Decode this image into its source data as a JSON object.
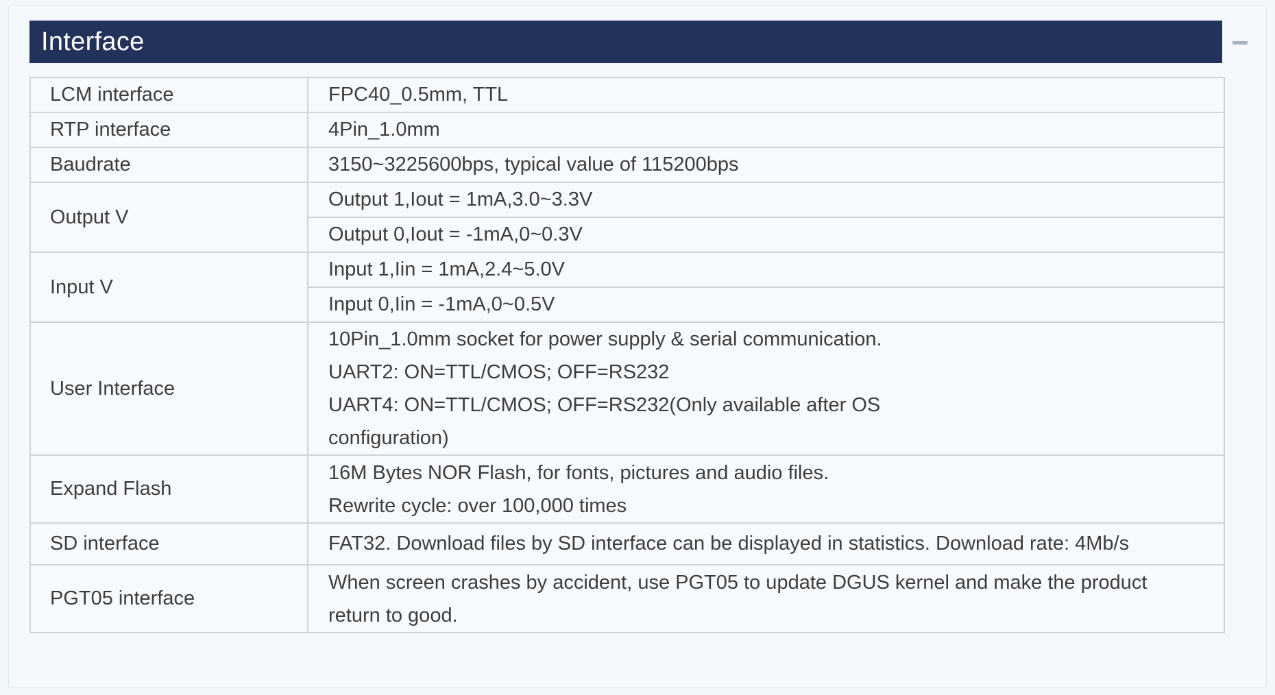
{
  "section": {
    "title": "Interface"
  },
  "rows": [
    {
      "label": "LCM interface",
      "values": [
        "FPC40_0.5mm, TTL"
      ]
    },
    {
      "label": "RTP interface",
      "values": [
        "4Pin_1.0mm"
      ]
    },
    {
      "label": "Baudrate",
      "values": [
        "3150~3225600bps, typical value of 115200bps"
      ]
    },
    {
      "label": "Output V",
      "values": [
        "Output 1,Iout = 1mA,3.0~3.3V",
        "Output 0,Iout = -1mA,0~0.3V"
      ]
    },
    {
      "label": "Input V",
      "values": [
        "Input 1,Iin = 1mA,2.4~5.0V",
        "Input 0,Iin = -1mA,0~0.5V"
      ]
    },
    {
      "label": "User Interface",
      "lines": [
        "10Pin_1.0mm socket for power supply & serial communication.",
        "UART2: ON=TTL/CMOS; OFF=RS232",
        "UART4: ON=TTL/CMOS; OFF=RS232(Only available after OS",
        "configuration)"
      ]
    },
    {
      "label": "Expand Flash",
      "lines": [
        "16M Bytes NOR Flash, for fonts, pictures and audio files.",
        "Rewrite cycle: over 100,000 times"
      ]
    },
    {
      "label": "SD interface",
      "values": [
        "FAT32. Download files by SD interface can be displayed in statistics. Download rate: 4Mb/s"
      ]
    },
    {
      "label": "PGT05 interface",
      "lines": [
        "When screen crashes by accident, use PGT05 to update DGUS kernel and make the product",
        "return to good."
      ]
    }
  ],
  "colors": {
    "header_bg": "#22325b",
    "page_bg": "#f2f7fb",
    "border": "#cfd4d9",
    "text": "#3d3d3d"
  }
}
